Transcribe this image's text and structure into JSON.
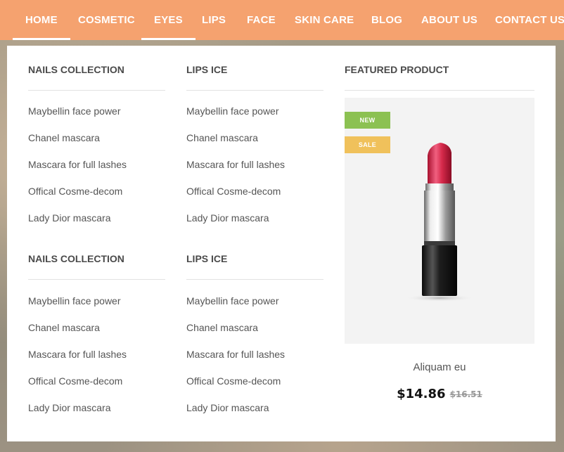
{
  "nav": {
    "items": [
      {
        "label": "HOME"
      },
      {
        "label": "COSMETIC"
      },
      {
        "label": "EYES"
      },
      {
        "label": "LIPS"
      },
      {
        "label": "FACE"
      },
      {
        "label": "SKIN CARE"
      },
      {
        "label": "BLOG"
      },
      {
        "label": "ABOUT US"
      },
      {
        "label": "CONTACT US"
      }
    ],
    "active": [
      "HOME",
      "EYES"
    ],
    "background": "#f5a26f"
  },
  "menu": {
    "sections": [
      {
        "title": "NAILS COLLECTION",
        "links": [
          "Maybellin face power",
          "Chanel mascara",
          "Mascara for full lashes",
          "Offical Cosme-decom",
          "Lady Dior mascara"
        ]
      },
      {
        "title": "LIPS ICE",
        "links": [
          "Maybellin face power",
          "Chanel mascara",
          "Mascara for full lashes",
          "Offical Cosme-decom",
          "Lady Dior mascara"
        ]
      },
      {
        "title": "NAILS COLLECTION",
        "links": [
          "Maybellin face power",
          "Chanel mascara",
          "Mascara for full lashes",
          "Offical Cosme-decom",
          "Lady Dior mascara"
        ]
      },
      {
        "title": "LIPS ICE",
        "links": [
          "Maybellin face power",
          "Chanel mascara",
          "Mascara for full lashes",
          "Offical Cosme-decom",
          "Lady Dior mascara"
        ]
      }
    ]
  },
  "featured": {
    "title": "FEATURED PRODUCT",
    "badge_new": "NEW",
    "badge_sale": "SALE",
    "badge_new_color": "#8cc152",
    "badge_sale_color": "#f0c15b",
    "image_icon": "lipstick-icon",
    "product_name": "Aliquam eu",
    "price": "$14.86",
    "old_price": "$16.51"
  }
}
